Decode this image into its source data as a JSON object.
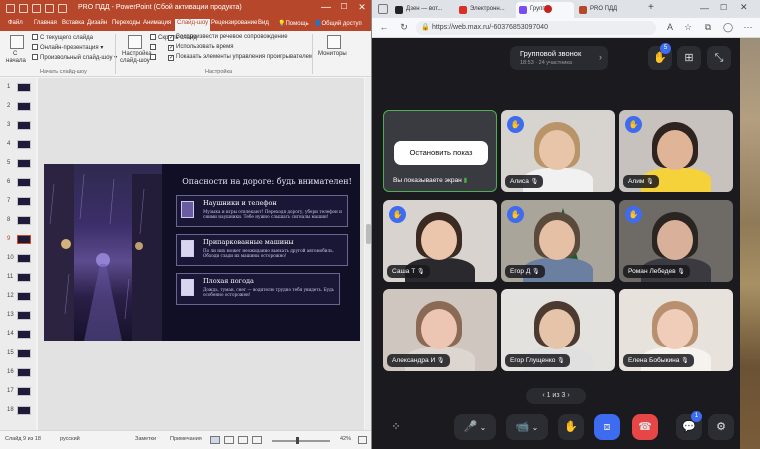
{
  "powerpoint": {
    "title": "PRO ПДД - PowerPoint (Сбой активации продукта)",
    "window_controls": [
      "—",
      "☐",
      "✕"
    ],
    "tabs": [
      "Файл",
      "Главная",
      "Вставка",
      "Дизайн",
      "Переходы",
      "Анимация",
      "Слайд-шоу",
      "Рецензирование",
      "Вид",
      "Помощь",
      "Общий доступ"
    ],
    "active_tab": "Слайд-шоу",
    "ribbon": {
      "btn_from_start_line1": "С",
      "btn_from_start_line2": "начала",
      "from_current": "С текущего слайда",
      "online": "Онлайн-презентация",
      "custom": "Произвольный слайд-шоу",
      "group_start": "Начать слайд-шоу",
      "setup_line1": "Настройка",
      "setup_line2": "слайд-шоу",
      "hide_slide": "Скрыть слайд",
      "rehearse": "",
      "record": "",
      "chk_narration": "Воспроизвести речевое сопровождение",
      "chk_timings": "Использовать время",
      "chk_controls": "Показать элементы управления проигрывателем",
      "group_setup": "Настройка",
      "monitors": "Мониторы"
    },
    "thumbs": [
      "1",
      "2",
      "3",
      "4",
      "5",
      "6",
      "7",
      "8",
      "9",
      "10",
      "11",
      "12",
      "13",
      "14",
      "15",
      "16",
      "17",
      "18"
    ],
    "selected_thumb": 9,
    "slide": {
      "title": "Опасности на дороге: будь внимателен!",
      "cards": [
        {
          "title": "Наушники и телефон",
          "body": "Музыка и игры отвлекают! Переходя дорогу, убери телефон и сними наушники. Тебе нужно слышать сигналы машин!"
        },
        {
          "title": "Припаркованные машины",
          "body": "По ли них может неожиданно выехать другой автомобиль. Обходи сзади их машины осторожно!"
        },
        {
          "title": "Плохая погода",
          "body": "Дождь, туман, снег — водителю трудно тебя увидеть. Будь особенно осторожен!"
        }
      ]
    },
    "status": {
      "slide": "Слайд 9 из 18",
      "lang": "русский",
      "notes": "Заметки",
      "comments": "Примечания",
      "zoom": "42%"
    }
  },
  "browser": {
    "tabs": [
      {
        "label": "Дзен — вот...",
        "color": "#222222"
      },
      {
        "label": "Электронн...",
        "color": "#d93025"
      },
      {
        "label": "Групп",
        "color": "#c5221f"
      },
      {
        "label": "PRO ПДД",
        "color": "#b7472a"
      }
    ],
    "active_tab": 2,
    "url": "https://web.max.ru/-60376853097040"
  },
  "call": {
    "title": "Групповой звонок",
    "subtitle": "18:53 · 24 участника",
    "hands_count": "5",
    "stop_show": "Остановить показ",
    "sharing_label": "Вы показываете экран",
    "participants": [
      {
        "name": "",
        "type": "screen"
      },
      {
        "name": "Алиса",
        "bg": "#d7d3cf",
        "hand": true,
        "skin": "#e8c4a8",
        "hair": "#b99468",
        "shirt": "#f1f1f1"
      },
      {
        "name": "Алим",
        "bg": "#c7c2bd",
        "hand": true,
        "skin": "#e0b496",
        "hair": "#2d2420",
        "shirt": "#f5d23a"
      },
      {
        "name": "Саша Т",
        "bg": "#d8d3ce",
        "hand": true,
        "skin": "#ecc5ad",
        "hair": "#3a2a22",
        "shirt": "#2a2a2e"
      },
      {
        "name": "Егор Д",
        "bg": "#a9a59a",
        "hand": true,
        "skin": "#e6c0a4",
        "hair": "#5a4a3c",
        "shirt": "#6b7fa0",
        "tree": true
      },
      {
        "name": "Роман Лебедев",
        "bg": "#6e6a66",
        "hand": true,
        "skin": "#d9b09a",
        "hair": "#2b2521",
        "shirt": "#3a3a40"
      },
      {
        "name": "Александра И",
        "bg": "#cfc6c0",
        "hand": false,
        "skin": "#ecc6b2",
        "hair": "#8a6a55",
        "shirt": "#ddd6d0"
      },
      {
        "name": "Егор Глущенко",
        "bg": "#e4e2df",
        "hand": false,
        "skin": "#e6c4aa",
        "hair": "#4a3a30",
        "shirt": "#e0e0e0"
      },
      {
        "name": "Елена Бобыкина",
        "bg": "#e7e2dc",
        "hand": false,
        "skin": "#f0cdb8",
        "hair": "#b89070",
        "shirt": "#f6f2ee"
      }
    ],
    "pager": "1 из 3",
    "chat_badge": "1"
  }
}
